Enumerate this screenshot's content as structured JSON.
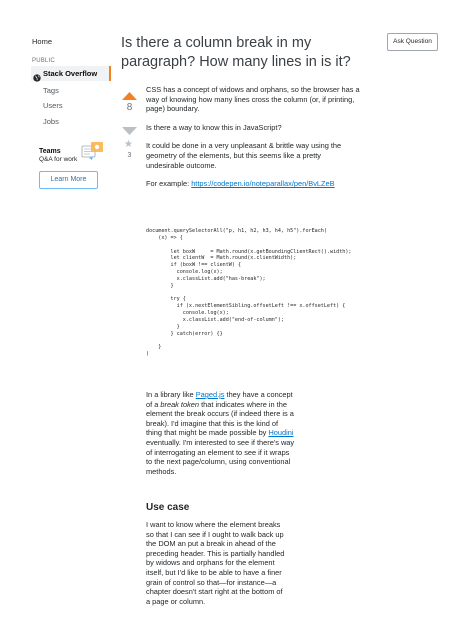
{
  "sidebar": {
    "home": "Home",
    "public_label": "PUBLIC",
    "stack_overflow": "Stack Overflow",
    "items": [
      {
        "label": "Tags"
      },
      {
        "label": "Users"
      },
      {
        "label": "Jobs"
      }
    ],
    "teams": {
      "title": "Teams",
      "subtitle": "Q&A for work",
      "button": "Learn More"
    }
  },
  "question": {
    "title": "Is there a column break in my paragraph? How many lines in is it?",
    "ask_button": "Ask Question",
    "votes": "8",
    "favorites": "3",
    "colors": {
      "accent": "#f48024",
      "link": "#0077cc",
      "button_border": "#6cbbf7"
    }
  },
  "body": {
    "p1": "CSS has a concept of widows and orphans, so the browser has a way of knowing how many lines cross the column (or, if printing, page) boundary.",
    "p2": "Is there a way to know this in JavaScript?",
    "p3": "It could be done in a very unpleasant & brittle way using the geometry of the elements, but this seems like a pretty undesirable outcome.",
    "p4_prefix": "For example: ",
    "p4_link": "https://codepen.io/noteparallax/pen/BvLZeB",
    "code": "document.querySelectorAll(\"p, h1, h2, h3, h4, h5\").forEach(\n    (x) => {\n\n        let boxW     = Math.round(x.getBoundingClientRect().width);\n        let clientW  = Math.round(x.clientWidth);\n        if (boxW !== clientW) {\n          console.log(x);\n          x.classList.add(\"has-break\");\n        }\n\n        try {\n          if (x.nextElementSibling.offsetLeft !== x.offsetLeft) {\n            console.log(x);\n            x.classList.add(\"end-of-column\");\n          }\n        } catch(error) {}\n\n    }\n)",
    "p5_a": "In a library like ",
    "p5_link1": "Paged.js",
    "p5_b": " they have a concept of a ",
    "p5_em": "break token",
    "p5_c": " that indicates where in the element the break occurs (if indeed there is a break). I'd imagine that this is the kind of thing that might be made possible by ",
    "p5_link2": "Houdini",
    "p5_d": " eventually. I'm interested to see if there's way of interrogating an element to see if it wraps to the next page/column, using conventional methods.",
    "h_use_case": "Use case",
    "p6": "I want to know where the element breaks so that I can see if I ought to walk back up the DOM an put a break in ahead of the preceding header. This is partially handled by widows and orphans for the element itself, but I'd like to be able to have a finer grain of control so that—for instance—a chapter doesn't start right at the bottom of a page or column."
  }
}
